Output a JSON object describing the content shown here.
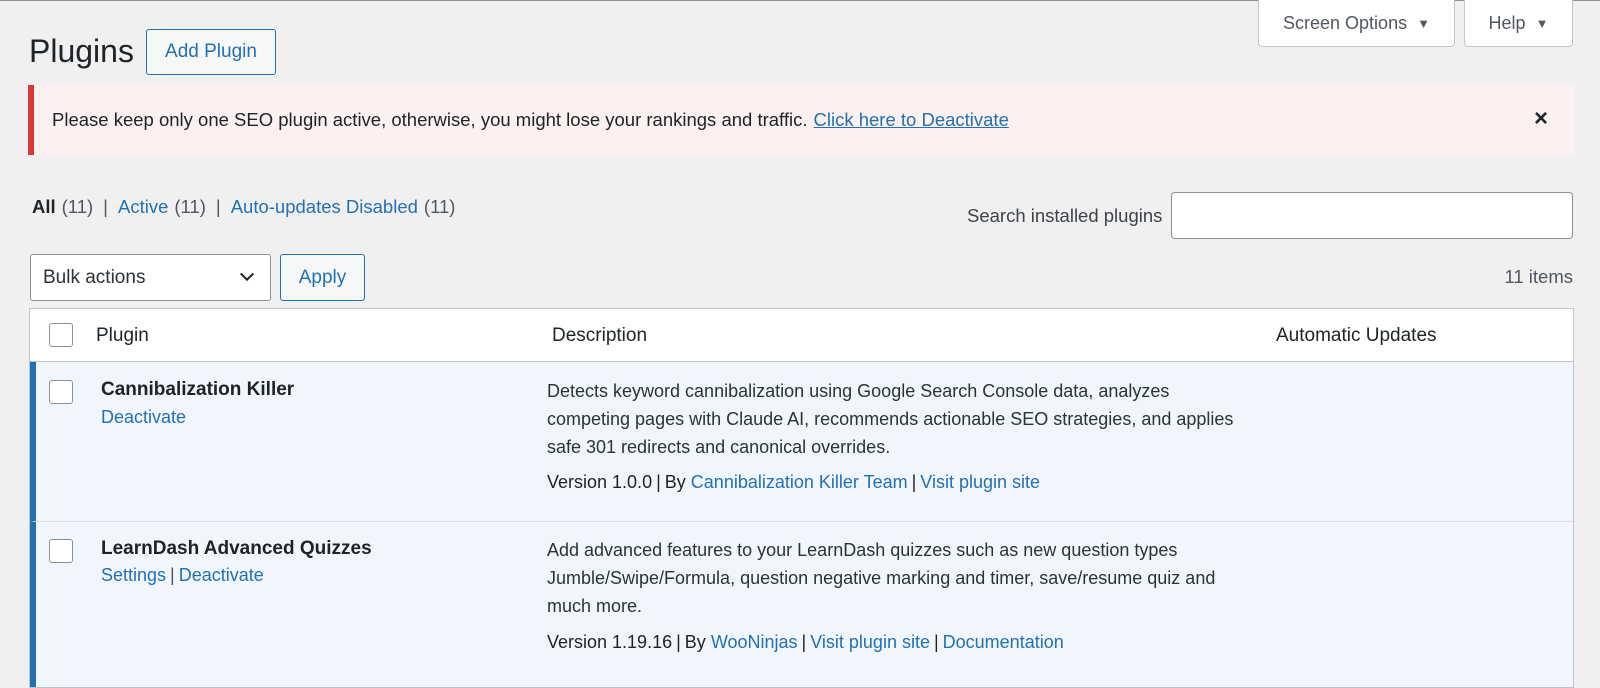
{
  "header": {
    "title": "Plugins",
    "add_button": "Add Plugin",
    "screen_options": "Screen Options",
    "help": "Help"
  },
  "notice": {
    "text": "Please keep only one SEO plugin active, otherwise, you might lose your rankings and traffic.",
    "link": "Click here to Deactivate",
    "close": "×"
  },
  "filters": {
    "all": {
      "label": "All",
      "count": "(11)"
    },
    "active": {
      "label": "Active",
      "count": "(11)"
    },
    "auto": {
      "label": "Auto-updates Disabled",
      "count": "(11)"
    },
    "sep": "|"
  },
  "search": {
    "label": "Search installed plugins",
    "value": ""
  },
  "bulk": {
    "selected": "Bulk actions",
    "apply": "Apply"
  },
  "items_count": "11 items",
  "table": {
    "columns": {
      "plugin": "Plugin",
      "description": "Description",
      "auto_updates": "Automatic Updates"
    },
    "rows": [
      {
        "name": "Cannibalization Killer",
        "actions": [
          "Deactivate"
        ],
        "description": "Detects keyword cannibalization using Google Search Console data, analyzes competing pages with Claude AI, recommends actionable SEO strategies, and applies safe 301 redirects and canonical overrides.",
        "version": "Version 1.0.0",
        "by": "By",
        "author": "Cannibalization Killer Team",
        "links": [
          "Visit plugin site"
        ]
      },
      {
        "name": "LearnDash Advanced Quizzes",
        "actions": [
          "Settings",
          "Deactivate"
        ],
        "description": "Add advanced features to your LearnDash quizzes such as new question types Jumble/Swipe/Formula, question negative marking and timer, save/resume quiz and much more.",
        "version": "Version 1.19.16",
        "by": "By",
        "author": "WooNinjas",
        "links": [
          "Visit plugin site",
          "Documentation"
        ]
      }
    ]
  }
}
